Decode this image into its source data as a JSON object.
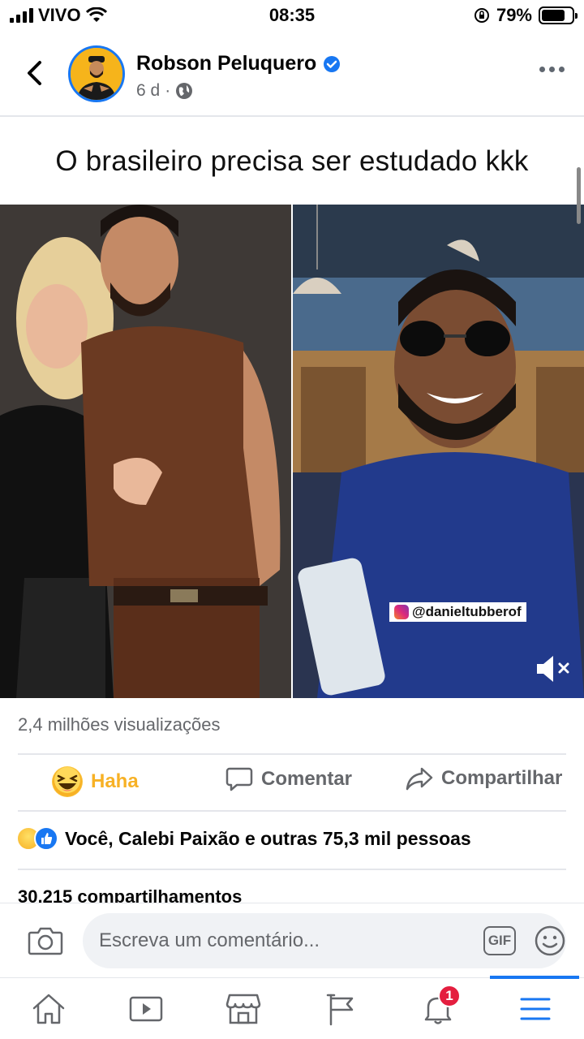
{
  "status_bar": {
    "carrier": "VIVO",
    "time": "08:35",
    "battery": "79%",
    "battery_level": 0.79
  },
  "post": {
    "author": "Robson Peluquero",
    "verified": true,
    "age": "6 d",
    "audience_icon": "globe-icon",
    "caption": "O brasileiro precisa ser estudado kkk",
    "watermark": "@danieltubberof",
    "views": "2,4 milhões visualizações",
    "reactions_text": "Você, Calebi Paixão e outras 75,3 mil pessoas",
    "shares": "30.215 compartilhamentos"
  },
  "actions": {
    "reaction_label": "Haha",
    "comment_label": "Comentar",
    "share_label": "Compartilhar"
  },
  "comment_bar": {
    "placeholder": "Escreva um comentário...",
    "gif_label": "GIF"
  },
  "tab_bar": {
    "items": [
      "home-icon",
      "video-icon",
      "marketplace-icon",
      "pages-flag-icon",
      "notifications-bell-icon",
      "menu-icon"
    ],
    "notification_count": "1",
    "active": "menu-icon"
  },
  "colors": {
    "brand": "#1877f2",
    "haha": "#f7b125",
    "badge": "#e41e3f",
    "secondary_text": "#65676b"
  }
}
